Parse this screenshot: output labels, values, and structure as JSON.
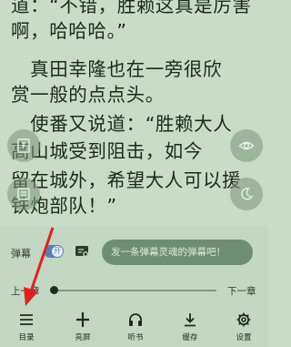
{
  "content": {
    "lines": [
      "道：“不错，胜赖这真是厉害",
      "啊，哈哈哈。”",
      "　真田幸隆也在一旁很欣",
      "赏一般的点点头。",
      "　使番又说道：“胜赖大人",
      "高山城受到阻击，如今",
      "留在城外，希望大人可以援",
      "铁炮部队！”",
      "　　　　　　　　　　　"
    ]
  },
  "barrage": {
    "label": "弹幕",
    "toggle_glyph": "开",
    "input_placeholder": "发一条弹幕灵魂的弹幕吧！"
  },
  "progress": {
    "prev_label": "上一章",
    "next_label": "下一章",
    "value_fraction": 0.0
  },
  "toolbar": {
    "items": [
      {
        "label": "目录",
        "icon": "menu-icon"
      },
      {
        "label": "亮屏",
        "icon": "brightness-icon"
      },
      {
        "label": "听书",
        "icon": "headphones-icon"
      },
      {
        "label": "缓存",
        "icon": "download-icon"
      },
      {
        "label": "设置",
        "icon": "gear-icon"
      }
    ]
  },
  "colors": {
    "background": "#c9dcc8",
    "panel": "#c4d7c3",
    "toggle_on": "#5a7fb8",
    "annotation": "#e02020"
  }
}
